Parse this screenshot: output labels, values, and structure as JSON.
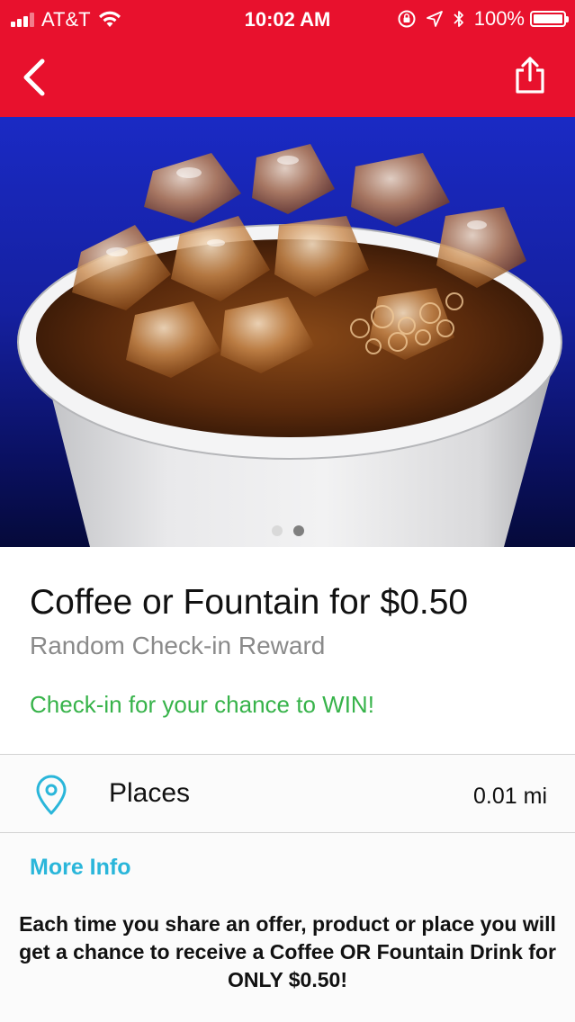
{
  "status_bar": {
    "carrier": "AT&T",
    "time": "10:02 AM",
    "battery": "100%",
    "icons": [
      "signal-bars-icon",
      "wifi-icon",
      "rotation-lock-icon",
      "location-arrow-icon",
      "bluetooth-icon",
      "battery-icon"
    ]
  },
  "nav": {
    "back_icon": "chevron-left-icon",
    "share_icon": "share-icon",
    "color": "#e8112d"
  },
  "hero": {
    "image": "iced-fountain-drink-cup-photo",
    "page_count": 2,
    "active_page": 2
  },
  "offer": {
    "title": "Coffee or Fountain for $0.50",
    "subtitle": "Random Check-in Reward",
    "cta": "Check-in for your chance to WIN!"
  },
  "places": {
    "icon": "map-pin-icon",
    "label": "Places",
    "distance": "0.01 mi"
  },
  "more_info": {
    "heading": "More Info",
    "text": "Each time you share an offer, product or place you will get a chance to receive a Coffee OR Fountain Drink for ONLY $0.50!"
  },
  "colors": {
    "brand_red": "#e8112d",
    "cta_green": "#37b34a",
    "link_blue": "#2ab6da",
    "hero_blue": "#1a2ac4"
  }
}
